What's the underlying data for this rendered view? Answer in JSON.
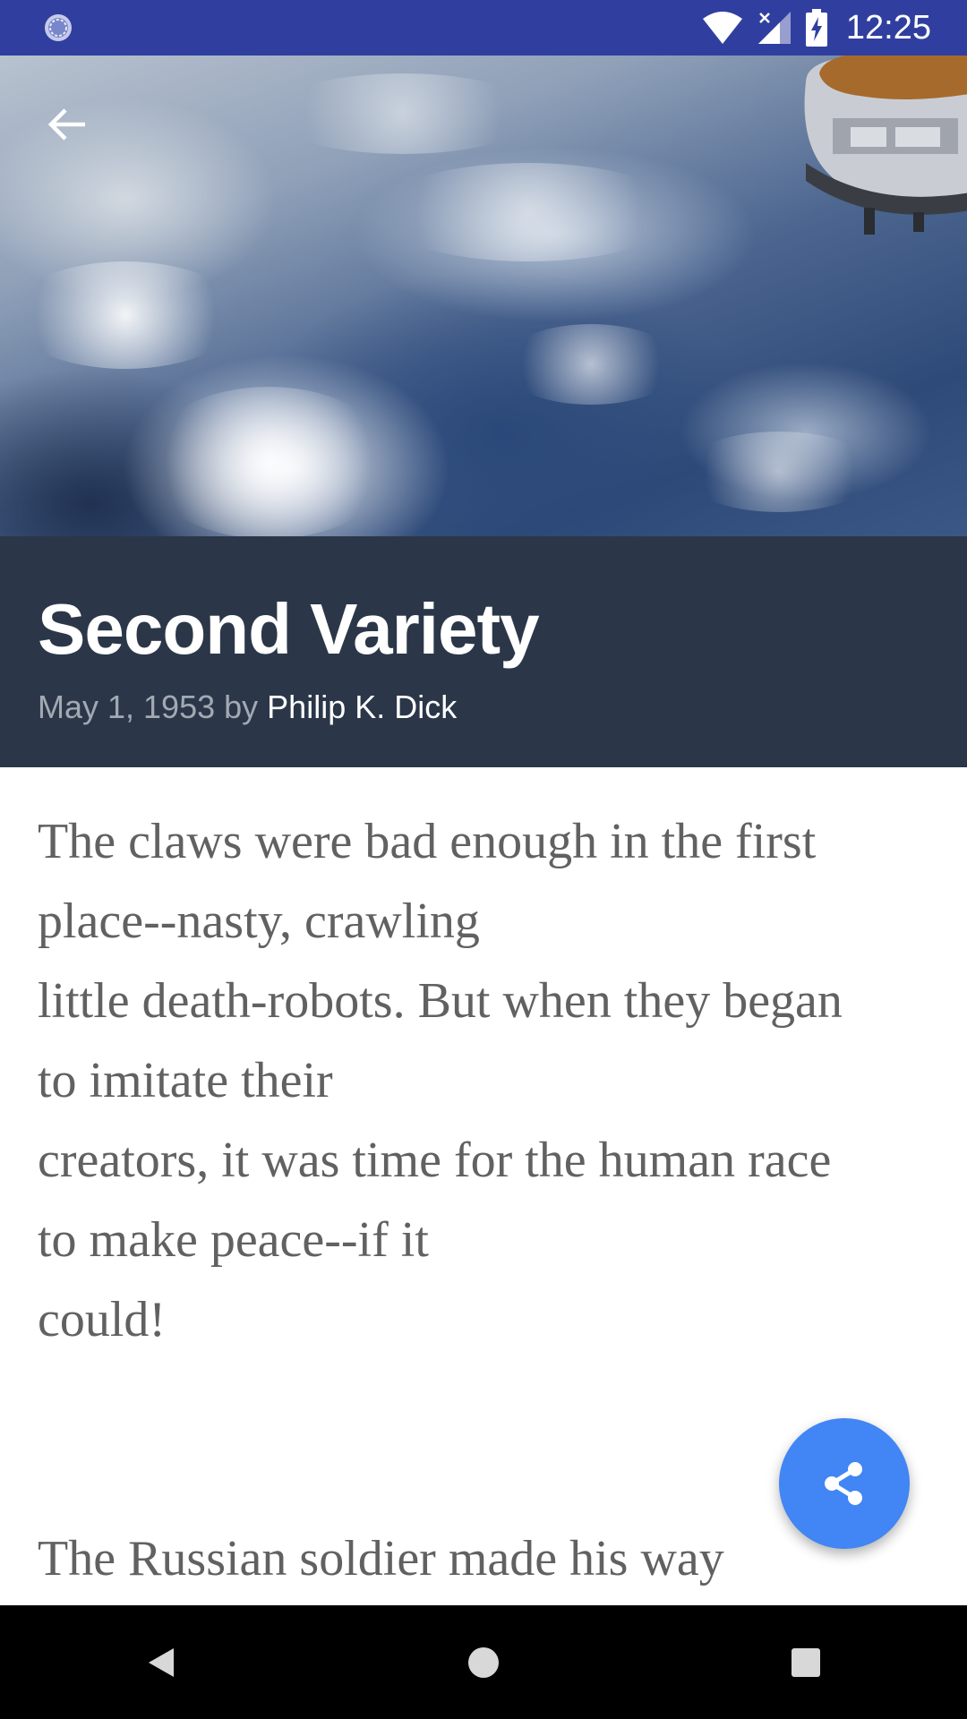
{
  "status_bar": {
    "time": "12:25",
    "icons": [
      "sync-icon",
      "wifi-icon",
      "signal-icon",
      "battery-charging-icon"
    ],
    "color": "#303F9F"
  },
  "hero": {
    "image": "earth-from-space-with-satellite",
    "back_icon": "arrow-back-icon"
  },
  "article": {
    "title": "Second Variety",
    "date_by": "May 1, 1953 by",
    "author": "Philip K. Dick",
    "header_color": "#2B3749",
    "lines_p1": [
      "The claws were bad enough in the first",
      "place--nasty, crawling",
      "little death-robots. But when they began",
      "to imitate their",
      "creators, it was time for the human race",
      "to make peace--if it",
      "could!"
    ],
    "p2": "The Russian soldier made his way"
  },
  "fab": {
    "icon": "share-icon",
    "color": "#4285F4"
  },
  "nav_bar": {
    "buttons": [
      "back-triangle-icon",
      "home-circle-icon",
      "recents-square-icon"
    ]
  }
}
